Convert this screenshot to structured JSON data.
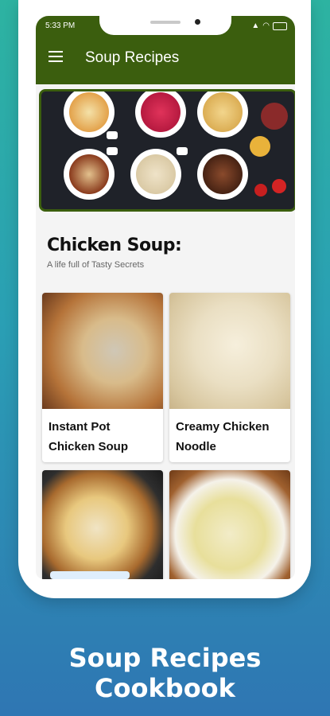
{
  "status_bar": {
    "time": "5:33 PM"
  },
  "app_bar": {
    "title": "Soup Recipes"
  },
  "section": {
    "title": "Chicken Soup:",
    "subtitle": "A life full of Tasty Secrets"
  },
  "recipes": [
    {
      "title": "Instant Pot Chicken Soup"
    },
    {
      "title": "Creamy Chicken Noodle"
    },
    {
      "title": ""
    },
    {
      "title": ""
    }
  ],
  "footer": {
    "title": "Soup Recipes Cookbook"
  },
  "colors": {
    "app_bar": "#3b5e0e",
    "background_top": "#2db3a1",
    "background_bottom": "#2f76b3"
  }
}
